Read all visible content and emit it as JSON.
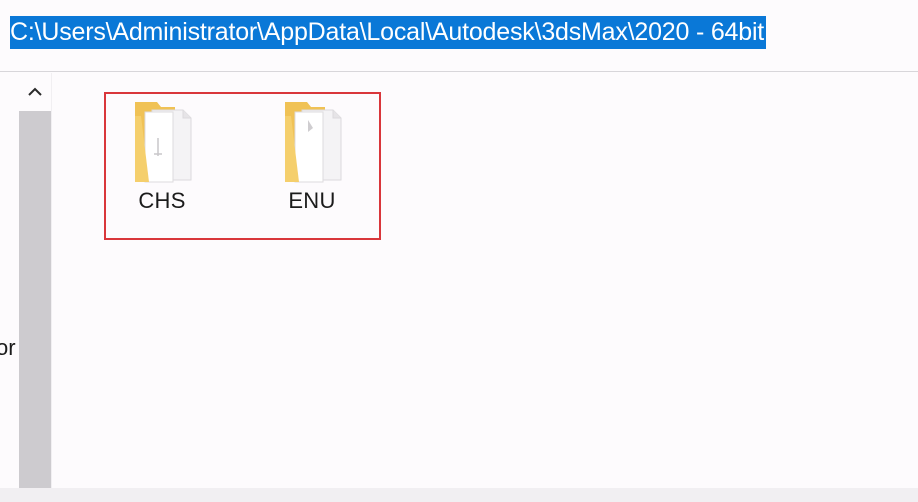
{
  "address_bar": {
    "path": "C:\\Users\\Administrator\\AppData\\Local\\Autodesk\\3dsMax\\2020 - 64bit"
  },
  "navigation_pane": {
    "partial_label": "or"
  },
  "scrollbar": {
    "up_arrow_icon": "chevron-up-icon"
  },
  "folders": [
    {
      "name": "CHS",
      "icon": "folder-icon"
    },
    {
      "name": "ENU",
      "icon": "folder-icon"
    }
  ],
  "colors": {
    "selection_highlight": "#0a78d7",
    "annotation_box": "#d9363b",
    "folder_yellow": "#f3c85a"
  }
}
